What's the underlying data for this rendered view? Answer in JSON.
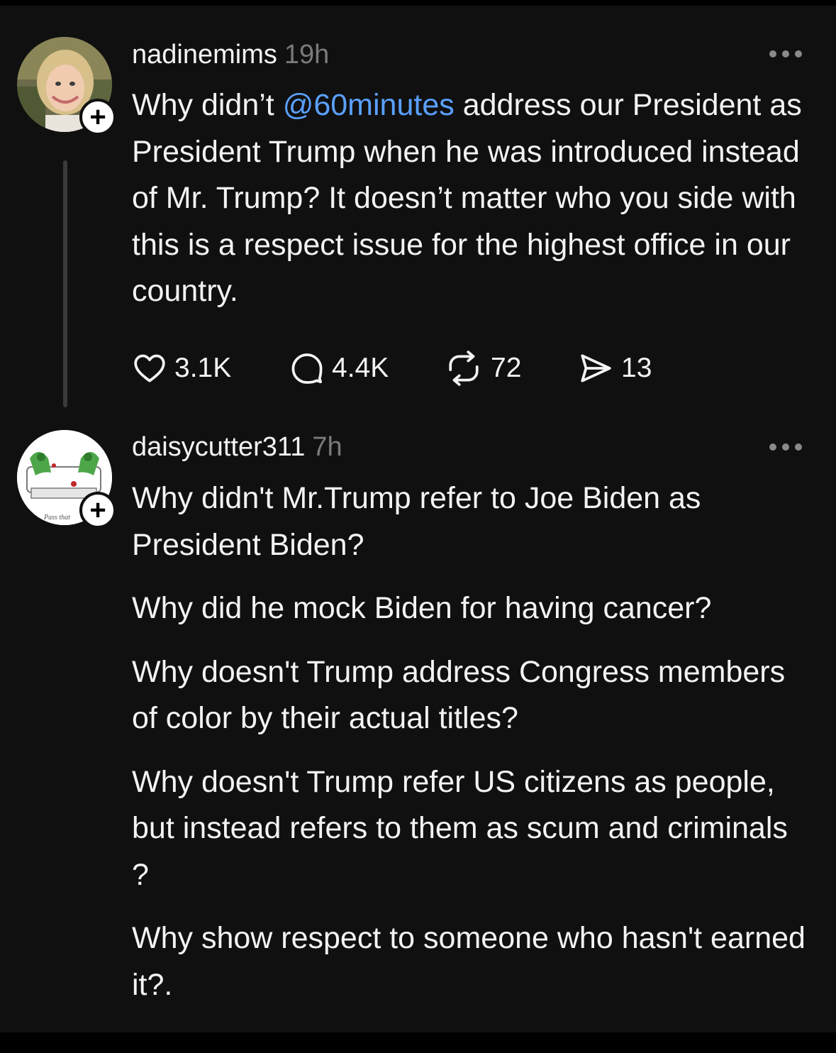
{
  "posts": [
    {
      "username": "nadinemims",
      "time": "19h",
      "follow_icon": "plus-icon",
      "body_parts": {
        "before": "Why didn’t ",
        "mention": "@60minutes",
        "after": " address our President as President Trump when he was introduced instead of Mr. Trump? It doesn’t matter who you side with this is a respect issue for the highest office in our country."
      },
      "actions": {
        "likes": "3.1K",
        "replies": "4.4K",
        "reposts": "72",
        "shares": "13"
      }
    },
    {
      "username": "daisycutter311",
      "time": "7h",
      "avatar_caption": "Pass that",
      "paragraphs": [
        "Why didn't Mr.Trump refer to Joe Biden as President Biden?",
        "Why did he mock Biden for having cancer?",
        "Why doesn't Trump address Congress members of color by their actual titles?",
        "Why doesn't Trump refer US citizens as people, but instead refers to them as scum and criminals ?",
        "Why show respect to someone who hasn't earned it?."
      ]
    }
  ],
  "colors": {
    "background": "#101010",
    "text": "#f3f3f3",
    "muted": "#7a7a7a",
    "mention": "#5aa0ff"
  }
}
